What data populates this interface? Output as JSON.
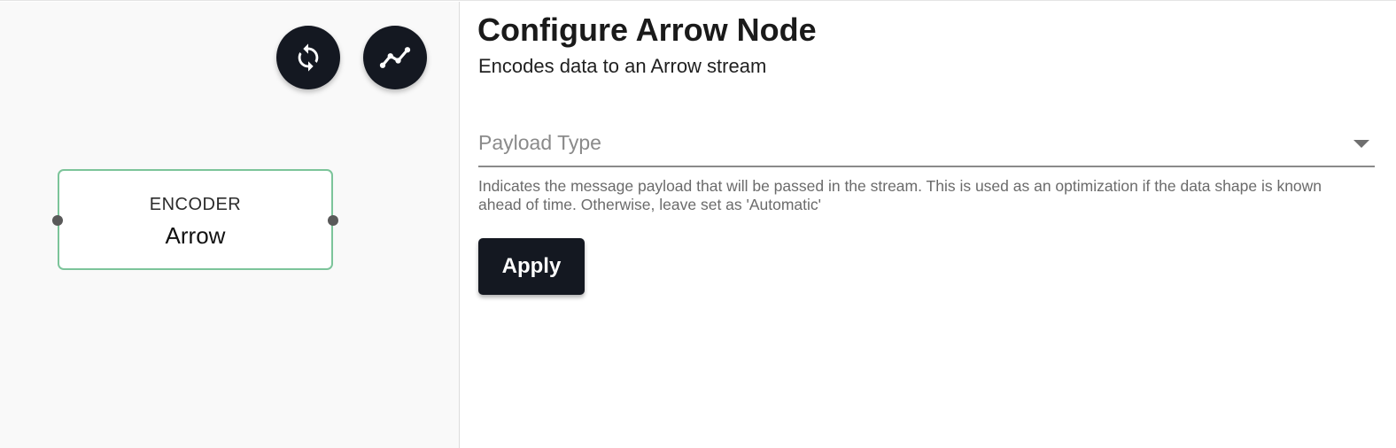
{
  "canvas": {
    "toolbar": {
      "refresh_icon": "refresh-icon",
      "metrics_icon": "line-chart-icon"
    },
    "node": {
      "type": "ENCODER",
      "name": "Arrow",
      "border_color": "#7cc49a"
    }
  },
  "panel": {
    "title": "Configure Arrow Node",
    "subtitle": "Encodes data to an Arrow stream",
    "payload_type": {
      "label": "Payload Type",
      "selected_value": "",
      "helper": "Indicates the message payload that will be passed in the stream. This is used as an optimization if the data shape is known ahead of time. Otherwise, leave set as 'Automatic'"
    },
    "apply_label": "Apply"
  },
  "colors": {
    "dark": "#141821",
    "canvas_bg": "#f9f9f9"
  }
}
